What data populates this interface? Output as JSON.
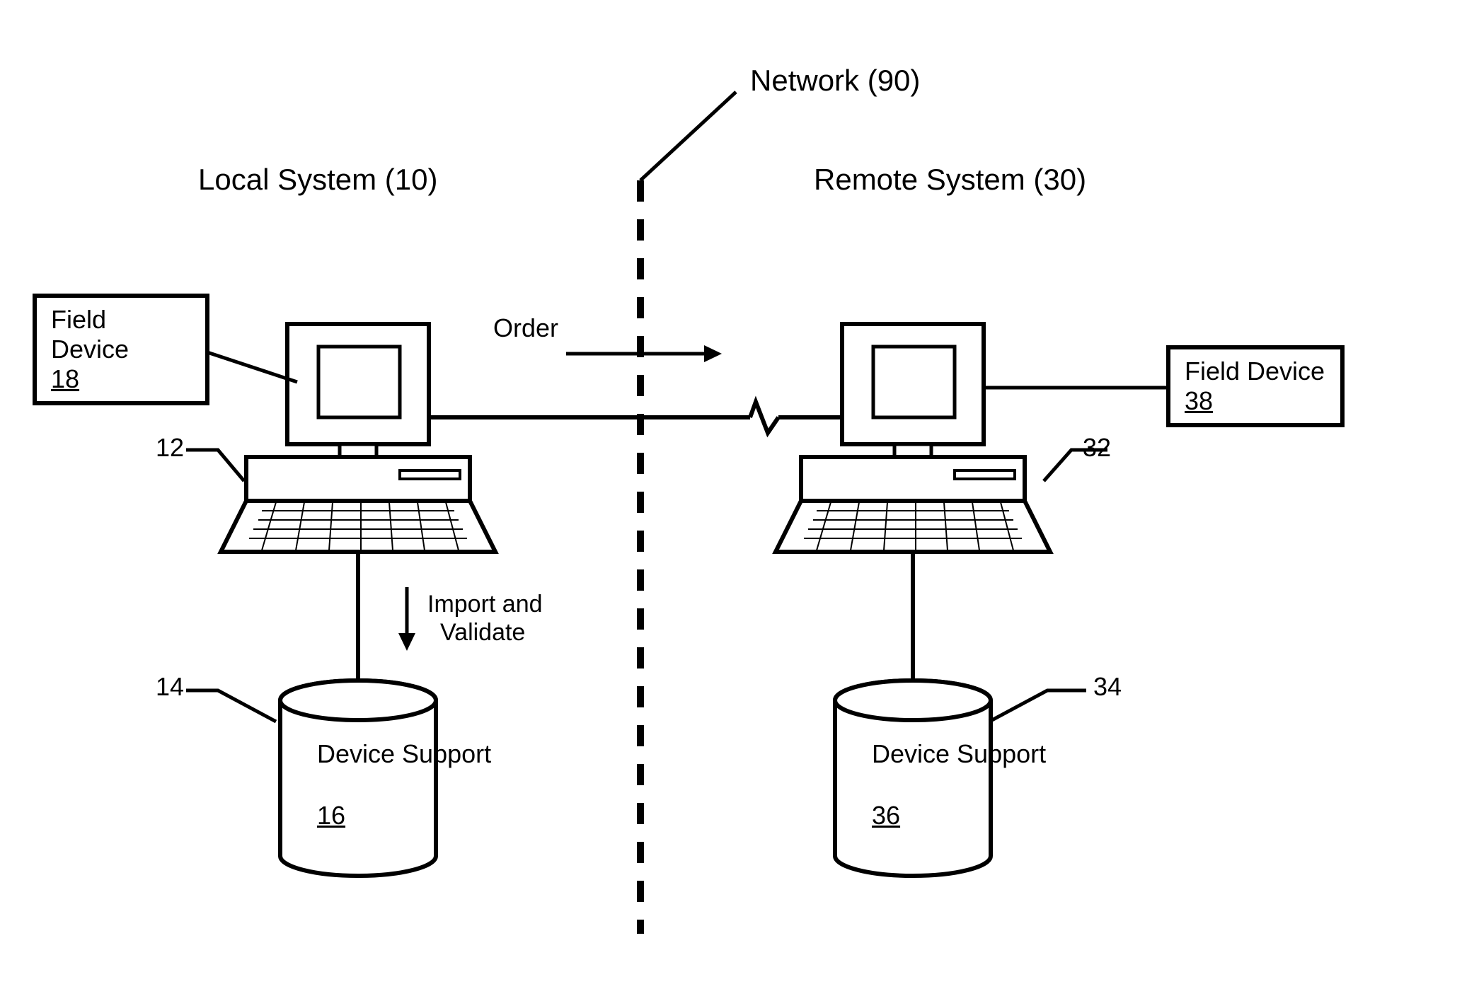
{
  "network": {
    "label": "Network (90)"
  },
  "local": {
    "title": "Local System (10)",
    "field_device": {
      "label": "Field Device",
      "ref": "18"
    },
    "computer_ref": "12",
    "db_ref": "14",
    "db": {
      "label": "Device Support",
      "ref": "16"
    },
    "import_label_1": "Import and",
    "import_label_2": "Validate",
    "order_label": "Order"
  },
  "remote": {
    "title": "Remote System (30)",
    "field_device": {
      "label": "Field Device",
      "ref": "38"
    },
    "computer_ref": "32",
    "db_ref": "34",
    "db": {
      "label": "Device Support",
      "ref": "36"
    }
  }
}
